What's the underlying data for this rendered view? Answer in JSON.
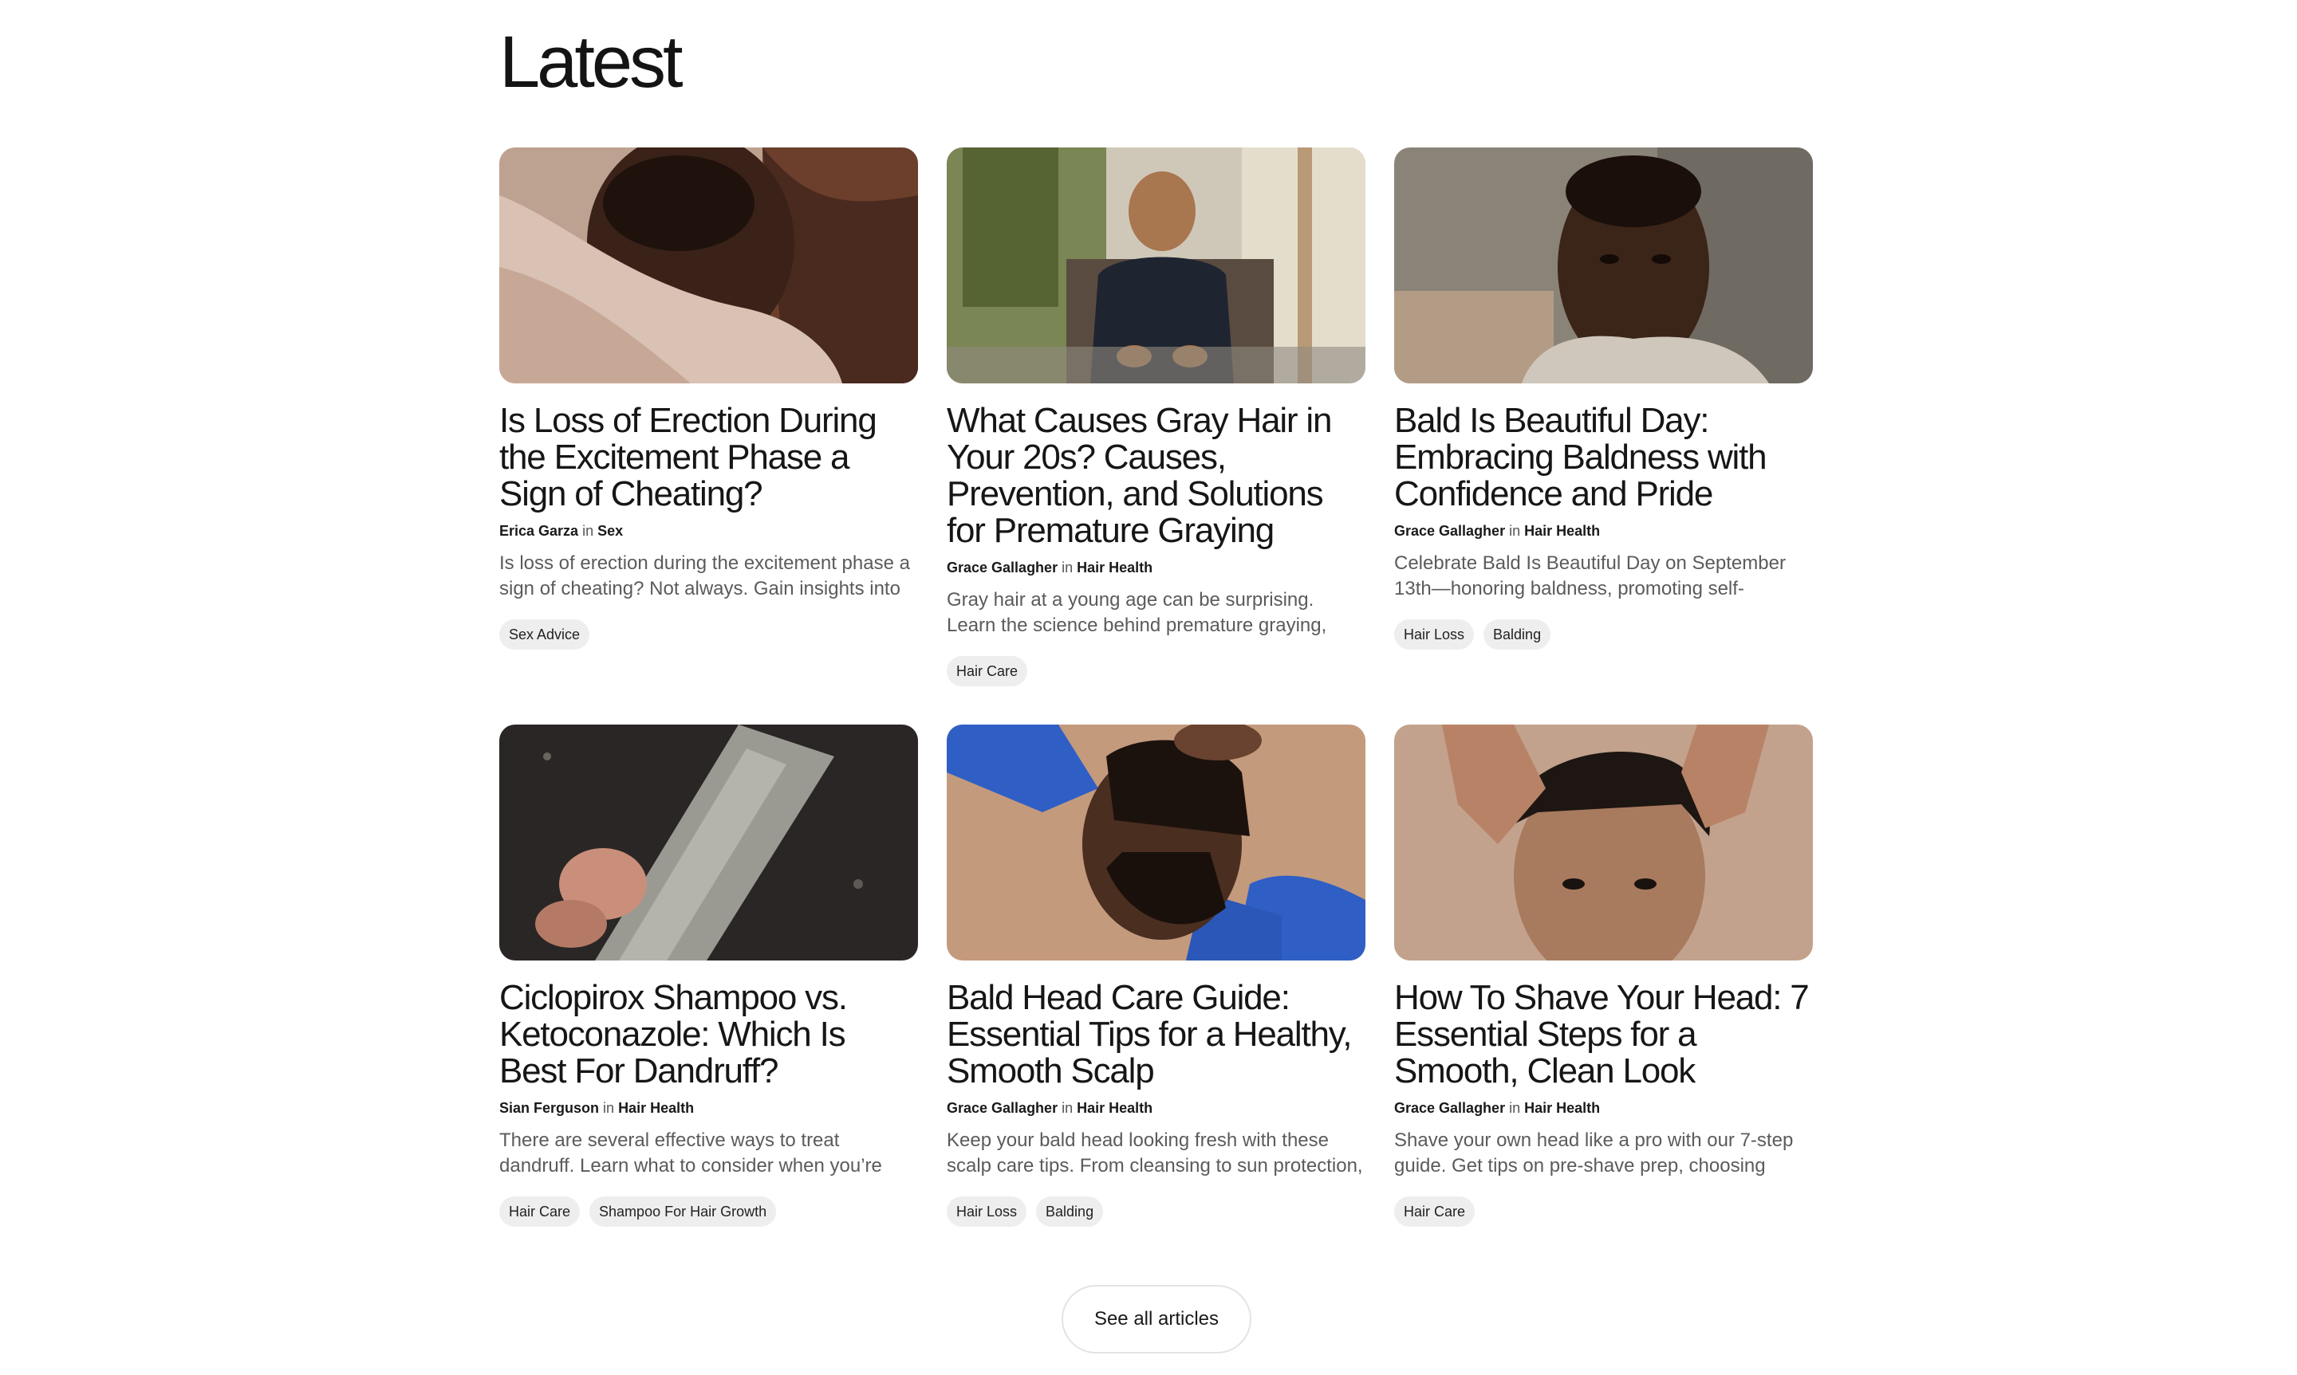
{
  "section": {
    "heading": "Latest",
    "see_all_label": "See all articles"
  },
  "articles": [
    {
      "title": "Is Loss of Erection During the Excitement Phase a Sign of Cheating?",
      "author": "Erica Garza",
      "in": "in",
      "category": "Sex",
      "excerpt": "Is loss of erection during the excitement phase a sign of cheating? Not always. Gain insights into t...",
      "tags": [
        "Sex Advice"
      ]
    },
    {
      "title": "What Causes Gray Hair in Your 20s? Causes, Prevention, and Solutions for Premature Graying",
      "author": "Grace Gallagher",
      "in": "in",
      "category": "Hair Health",
      "excerpt": "Gray hair at a young age can be surprising. Learn the science behind premature graying, common...",
      "tags": [
        "Hair Care"
      ]
    },
    {
      "title": "Bald Is Beautiful Day: Embracing Baldness with Confidence and Pride",
      "author": "Grace Gallagher",
      "in": "in",
      "category": "Hair Health",
      "excerpt": "Celebrate Bald Is Beautiful Day on September 13th—honoring baldness, promoting self-confidence,...",
      "tags": [
        "Hair Loss",
        "Balding"
      ]
    },
    {
      "title": "Ciclopirox Shampoo vs. Ketoconazole: Which Is Best For Dandruff?",
      "author": "Sian Ferguson",
      "in": "in",
      "category": "Hair Health",
      "excerpt": "There are several effective ways to treat dandruff. Learn what to consider when you’re weighing...",
      "tags": [
        "Hair Care",
        "Shampoo For Hair Growth"
      ]
    },
    {
      "title": "Bald Head Care Guide: Essential Tips for a Healthy, Smooth Scalp",
      "author": "Grace Gallagher",
      "in": "in",
      "category": "Hair Health",
      "excerpt": "Keep your bald head looking fresh with these scalp care tips. From cleansing to sun protection, learn...",
      "tags": [
        "Hair Loss",
        "Balding"
      ]
    },
    {
      "title": "How To Shave Your Head: 7 Essential Steps for a Smooth, Clean Look",
      "author": "Grace Gallagher",
      "in": "in",
      "category": "Hair Health",
      "excerpt": "Shave your own head like a pro with our 7-step guide. Get tips on pre-shave prep, choosing the...",
      "tags": [
        "Hair Care"
      ]
    }
  ],
  "images": [
    {
      "icon": "photo-couple-embrace",
      "colors": [
        "#b89a8a",
        "#3a261c",
        "#7a4a36",
        "#e2cfc4"
      ]
    },
    {
      "icon": "photo-man-seated-window",
      "colors": [
        "#cfc8b8",
        "#1f2530",
        "#6f7d4a",
        "#a8805a"
      ]
    },
    {
      "icon": "photo-man-portrait",
      "colors": [
        "#8a8378",
        "#3b2418",
        "#b39c86",
        "#cfc7bb"
      ]
    },
    {
      "icon": "photo-shampoo-bottle",
      "colors": [
        "#2a2626",
        "#9a9a92",
        "#c98f7a",
        "#d9d4cc"
      ]
    },
    {
      "icon": "photo-man-blue-shirt",
      "colors": [
        "#c49a7d",
        "#2f5fc4",
        "#2b1a12",
        "#b88a6a"
      ]
    },
    {
      "icon": "photo-man-hands-on-head",
      "colors": [
        "#c2a28c",
        "#1d1612",
        "#a87a5e",
        "#d6b8a2"
      ]
    }
  ]
}
